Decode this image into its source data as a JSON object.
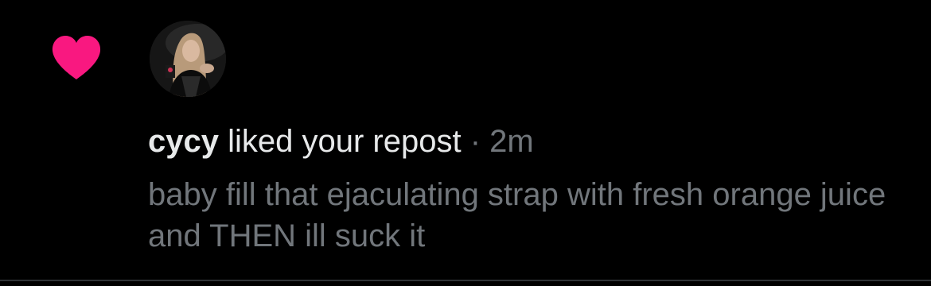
{
  "notification": {
    "type_icon": "heart-icon",
    "actor_avatar": "avatar",
    "actor_name": "cycy",
    "action_text": "liked your repost",
    "separator": "·",
    "time_ago": "2m",
    "post_text": "baby fill that ejaculating strap with fresh orange juice and THEN ill suck it"
  },
  "colors": {
    "background": "#000000",
    "heart": "#f91880",
    "primary_text": "#e7e9ea",
    "secondary_text": "#71767b",
    "divider": "#2f3336"
  }
}
